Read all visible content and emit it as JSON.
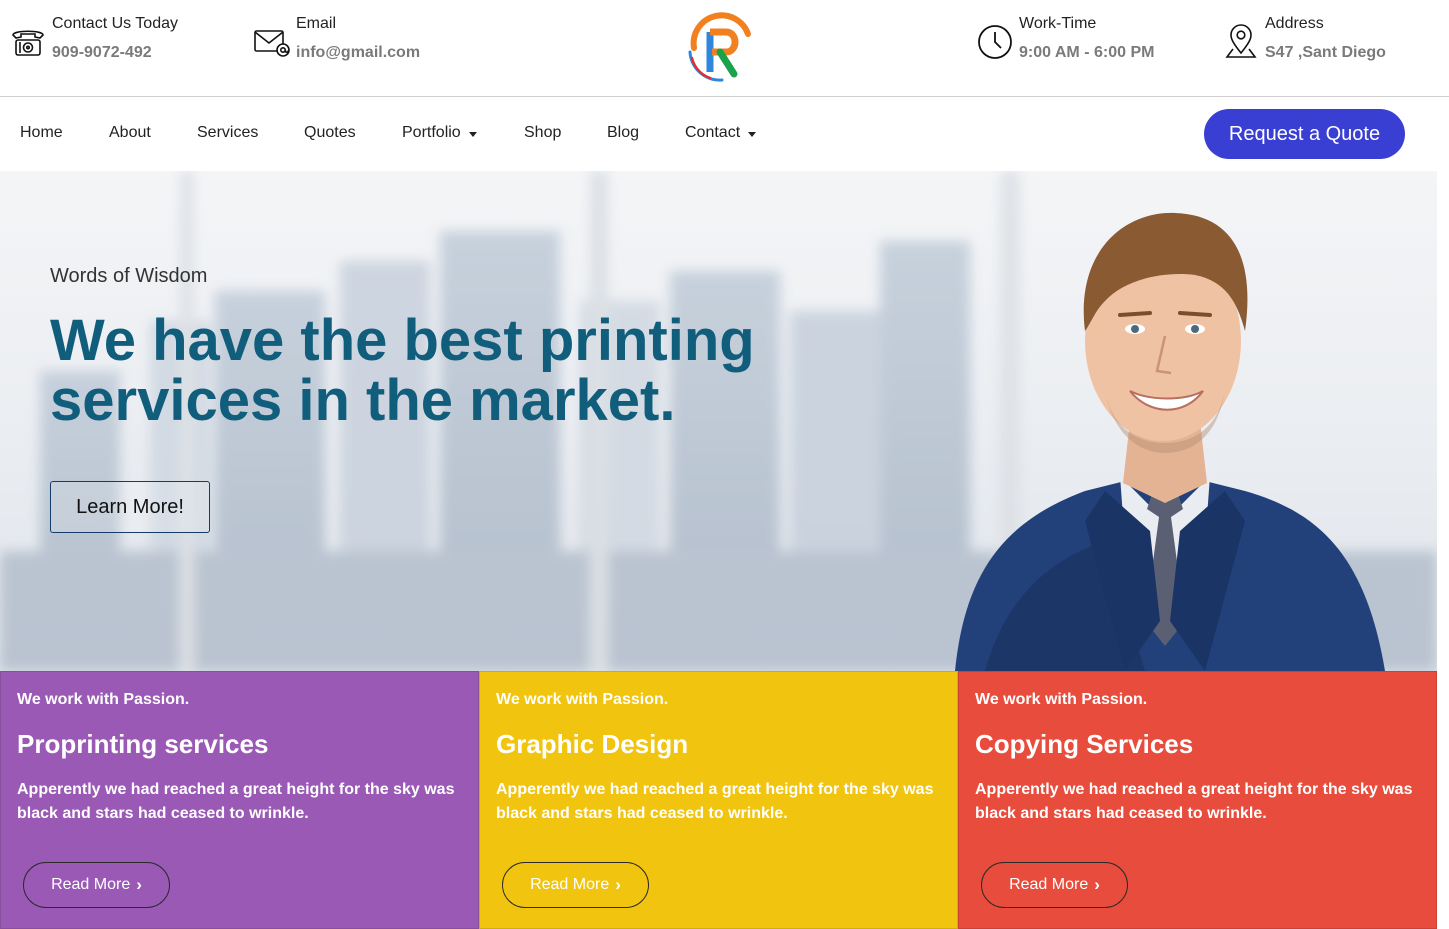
{
  "contact": {
    "phone": {
      "label": "Contact Us Today",
      "value": "909-9072-492",
      "icon": "telephone-icon"
    },
    "email": {
      "label": "Email",
      "value": "info@gmail.com",
      "icon": "envelope-icon"
    },
    "worktime": {
      "label": "Work-Time",
      "value": "9:00 AM - 6:00 PM",
      "icon": "clock-icon"
    },
    "address": {
      "label": "Address",
      "value": "S47 ,Sant Diego",
      "icon": "map-pin-icon"
    }
  },
  "logo": {
    "icon": "brand-logo",
    "letter": "R"
  },
  "nav": {
    "items": [
      {
        "label": "Home"
      },
      {
        "label": "About"
      },
      {
        "label": "Services"
      },
      {
        "label": "Quotes"
      },
      {
        "label": "Portfolio",
        "dropdown": true
      },
      {
        "label": "Shop"
      },
      {
        "label": "Blog"
      },
      {
        "label": "Contact",
        "dropdown": true
      }
    ],
    "cta_label": "Request a Quote",
    "cta_color": "#3a3fd3"
  },
  "hero": {
    "subtitle": "Words of Wisdom",
    "headline": "We have the best printing services in the market.",
    "button_label": "Learn More!",
    "headline_color": "#115d7c"
  },
  "cards": [
    {
      "kicker": "We work with Passion.",
      "title": "Proprinting services",
      "desc": "Apperently we had reached a great height for the sky was black and stars had ceased to wrinkle.",
      "button_label": "Read More",
      "color": "#9b59b6"
    },
    {
      "kicker": "We work with Passion.",
      "title": "Graphic Design",
      "desc": "Apperently we had reached a great height for the sky was black and stars had ceased to wrinkle.",
      "button_label": "Read More",
      "color": "#f1c40f"
    },
    {
      "kicker": "We work with Passion.",
      "title": "Copying Services",
      "desc": "Apperently we had reached a great height for the sky was black and stars had ceased to wrinkle.",
      "button_label": "Read More",
      "color": "#e74c3c"
    }
  ]
}
